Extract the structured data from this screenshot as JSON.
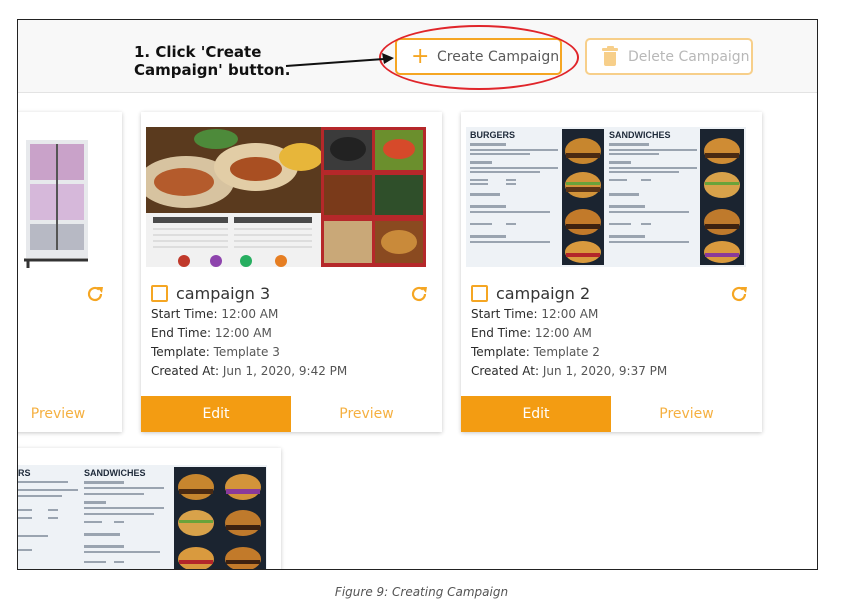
{
  "toolbar": {
    "create_label": "Create Campaign",
    "delete_label": "Delete Campaign",
    "accent_color": "#f5a623"
  },
  "annotation": {
    "text": "1. Click 'Create\nCampaign' button.",
    "color": "#e0252a"
  },
  "cards": [
    {
      "title": "",
      "preview_label": "Preview"
    },
    {
      "title": "campaign 3",
      "start_label": "Start Time:",
      "start_value": "12:00 AM",
      "end_label": "End Time:",
      "end_value": "12:00 AM",
      "template_label": "Template:",
      "template_value": "Template 3",
      "created_label": "Created At:",
      "created_value": "Jun 1, 2020, 9:42 PM",
      "edit_label": "Edit",
      "preview_label": "Preview"
    },
    {
      "title": "campaign 2",
      "start_label": "Start Time:",
      "start_value": "12:00 AM",
      "end_label": "End Time:",
      "end_value": "12:00 AM",
      "template_label": "Template:",
      "template_value": "Template 2",
      "created_label": "Created At:",
      "created_value": "Jun 1, 2020, 9:37 PM",
      "edit_label": "Edit",
      "preview_label": "Preview"
    }
  ],
  "menu_text": {
    "burgers": "BURGERS",
    "sandwiches": "SANDWICHES",
    "rs": "RS"
  },
  "caption": "Figure 9: Creating Campaign"
}
